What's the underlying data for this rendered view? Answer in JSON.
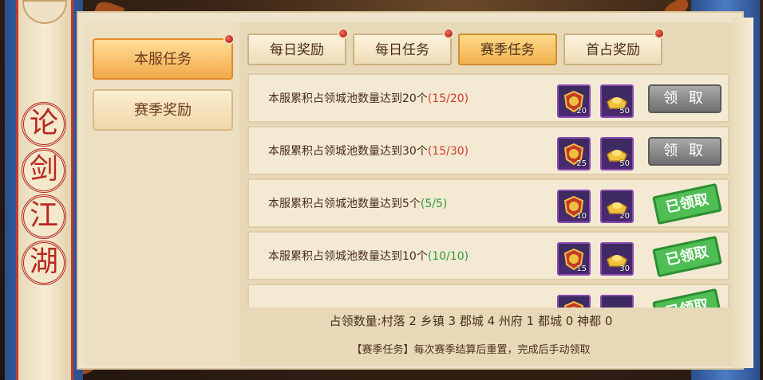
{
  "window": {
    "title_chars": [
      "论",
      "剑",
      "江",
      "湖"
    ]
  },
  "sidebar": {
    "items": [
      {
        "label": "本服任务",
        "active": true
      },
      {
        "label": "赛季奖励",
        "active": false
      }
    ]
  },
  "tabs": [
    {
      "label": "每日奖励",
      "active": false,
      "alert": true
    },
    {
      "label": "每日任务",
      "active": false,
      "alert": true
    },
    {
      "label": "赛季任务",
      "active": true,
      "alert": false
    },
    {
      "label": "首占奖励",
      "active": false,
      "alert": true
    }
  ],
  "tasks": [
    {
      "text": "本服累积占领城池数量达到20个",
      "progress": "(15/20)",
      "done": false,
      "rewards": [
        {
          "icon": "merit-medal-icon",
          "qty": "20"
        },
        {
          "icon": "gold-ingot-icon",
          "qty": "50"
        }
      ],
      "action_label": "领 取"
    },
    {
      "text": "本服累积占领城池数量达到30个",
      "progress": "(15/30)",
      "done": false,
      "rewards": [
        {
          "icon": "merit-medal-icon",
          "qty": "25"
        },
        {
          "icon": "gold-ingot-icon",
          "qty": "50"
        }
      ],
      "action_label": "领 取"
    },
    {
      "text": "本服累积占领城池数量达到5个",
      "progress": "(5/5)",
      "done": true,
      "rewards": [
        {
          "icon": "merit-medal-icon",
          "qty": "10"
        },
        {
          "icon": "gold-ingot-icon",
          "qty": "20"
        }
      ],
      "action_label": "已领取"
    },
    {
      "text": "本服累积占领城池数量达到10个",
      "progress": "(10/10)",
      "done": true,
      "rewards": [
        {
          "icon": "merit-medal-icon",
          "qty": "15"
        },
        {
          "icon": "gold-ingot-icon",
          "qty": "30"
        }
      ],
      "action_label": "已领取"
    },
    {
      "text": "",
      "progress": "",
      "done": true,
      "rewards": [
        {
          "icon": "merit-medal-icon",
          "qty": ""
        },
        {
          "icon": "gold-ingot-icon",
          "qty": ""
        }
      ],
      "action_label": "已领取"
    }
  ],
  "footer": {
    "count_line": "占领数量:村落 2 乡镇 3 郡城 4 州府 1 都城 0 神都 0",
    "note_line": "【赛季任务】每次赛季结算后重置，完成后手动领取"
  },
  "colors": {
    "progress_incomplete": "#d3382b",
    "progress_complete": "#2f9a3a",
    "claimed_stamp": "#4fbf55"
  }
}
